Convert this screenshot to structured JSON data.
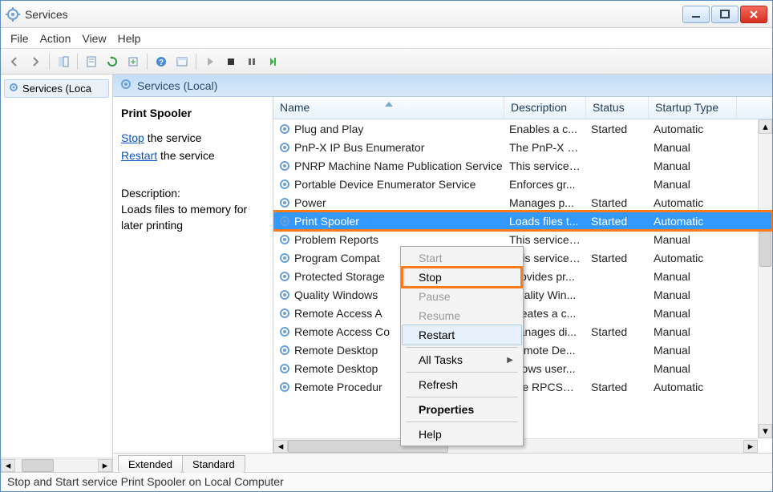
{
  "titlebar": {
    "title": "Services"
  },
  "menu": {
    "file": "File",
    "action": "Action",
    "view": "View",
    "help": "Help"
  },
  "tree": {
    "item": "Services (Loca"
  },
  "panel_header": "Services (Local)",
  "details": {
    "name": "Print Spooler",
    "stop": "Stop",
    "stop_suffix": " the service",
    "restart": "Restart",
    "restart_suffix": " the service",
    "desc_label": "Description:",
    "description": "Loads files to memory for later printing"
  },
  "columns": {
    "name": "Name",
    "desc": "Description",
    "status": "Status",
    "stype": "Startup Type"
  },
  "rows": [
    {
      "name": "Plug and Play",
      "desc": "Enables a c...",
      "status": "Started",
      "stype": "Automatic",
      "sel": false
    },
    {
      "name": "PnP-X IP Bus Enumerator",
      "desc": "The PnP-X b...",
      "status": "",
      "stype": "Manual",
      "sel": false
    },
    {
      "name": "PNRP Machine Name Publication Service",
      "desc": "This service ...",
      "status": "",
      "stype": "Manual",
      "sel": false
    },
    {
      "name": "Portable Device Enumerator Service",
      "desc": "Enforces gr...",
      "status": "",
      "stype": "Manual",
      "sel": false
    },
    {
      "name": "Power",
      "desc": "Manages p...",
      "status": "Started",
      "stype": "Automatic",
      "sel": false
    },
    {
      "name": "Print Spooler",
      "desc": "Loads files t...",
      "status": "Started",
      "stype": "Automatic",
      "sel": true
    },
    {
      "name": "Problem Reports",
      "desc": "This service ...",
      "status": "",
      "stype": "Manual",
      "sel": false
    },
    {
      "name": "Program Compat",
      "desc": "This service ...",
      "status": "Started",
      "stype": "Automatic",
      "sel": false
    },
    {
      "name": "Protected Storage",
      "desc": "Provides pr...",
      "status": "",
      "stype": "Manual",
      "sel": false
    },
    {
      "name": "Quality Windows",
      "desc": "Quality Win...",
      "status": "",
      "stype": "Manual",
      "sel": false
    },
    {
      "name": "Remote Access A",
      "desc": "Creates a c...",
      "status": "",
      "stype": "Manual",
      "sel": false
    },
    {
      "name": "Remote Access Co",
      "desc": "Manages di...",
      "status": "Started",
      "stype": "Manual",
      "sel": false
    },
    {
      "name": "Remote Desktop",
      "desc": "Remote De...",
      "status": "",
      "stype": "Manual",
      "sel": false
    },
    {
      "name": "Remote Desktop",
      "desc": "Allows user...",
      "status": "",
      "stype": "Manual",
      "sel": false
    },
    {
      "name": "Remote Procedur",
      "desc": "The RPCSS s...",
      "status": "Started",
      "stype": "Automatic",
      "sel": false
    }
  ],
  "context_menu": {
    "start": "Start",
    "stop": "Stop",
    "pause": "Pause",
    "resume": "Resume",
    "restart": "Restart",
    "alltasks": "All Tasks",
    "refresh": "Refresh",
    "properties": "Properties",
    "help": "Help"
  },
  "tabs": {
    "extended": "Extended",
    "standard": "Standard"
  },
  "statusbar": "Stop and Start service Print Spooler on Local Computer"
}
